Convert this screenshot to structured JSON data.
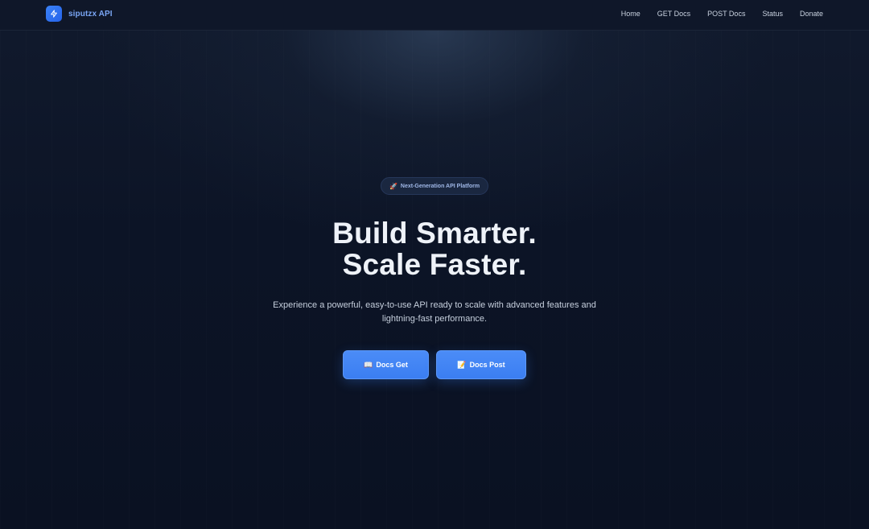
{
  "navbar": {
    "brand_name": "siputzx API",
    "brand_icon": "lightning-bolt-icon",
    "links": [
      {
        "label": "Home"
      },
      {
        "label": "GET Docs"
      },
      {
        "label": "POST Docs"
      },
      {
        "label": "Status"
      },
      {
        "label": "Donate"
      }
    ]
  },
  "hero": {
    "badge": {
      "icon": "🚀",
      "label": "Next-Generation API Platform"
    },
    "title_line1": "Build Smarter.",
    "title_line2": "Scale Faster.",
    "subtitle": "Experience a powerful, easy-to-use API ready to scale with advanced features and lightning-fast performance.",
    "buttons": [
      {
        "icon": "📖",
        "label": "Docs Get"
      },
      {
        "icon": "📝",
        "label": "Docs Post"
      }
    ]
  },
  "colors": {
    "accent": "#3b82f6",
    "background": "#0b1224",
    "brand_text": "#7aa6f5"
  }
}
